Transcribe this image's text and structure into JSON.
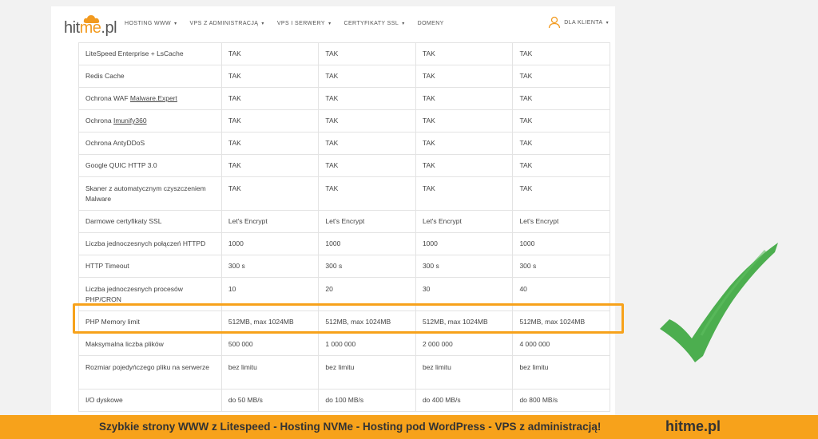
{
  "header": {
    "logo": "hitme.pl",
    "nav": [
      "HOSTING WWW",
      "VPS Z ADMINISTRACJĄ",
      "VPS I SERWERY",
      "CERTYFIKATY SSL",
      "DOMENY"
    ],
    "client_label": "DLA KLIENTA"
  },
  "table": {
    "rows": [
      {
        "label": "LiteSpeed Enterprise + LsCache",
        "values": [
          "TAK",
          "TAK",
          "TAK",
          "TAK"
        ]
      },
      {
        "label": "Redis Cache",
        "values": [
          "TAK",
          "TAK",
          "TAK",
          "TAK"
        ]
      },
      {
        "label_prefix": "Ochrona WAF ",
        "label_link": "Malware.Expert",
        "values": [
          "TAK",
          "TAK",
          "TAK",
          "TAK"
        ]
      },
      {
        "label_prefix": "Ochrona ",
        "label_link": "Imunify360",
        "values": [
          "TAK",
          "TAK",
          "TAK",
          "TAK"
        ]
      },
      {
        "label": "Ochrona AntyDDoS",
        "values": [
          "TAK",
          "TAK",
          "TAK",
          "TAK"
        ]
      },
      {
        "label": "Google QUIC HTTP 3.0",
        "values": [
          "TAK",
          "TAK",
          "TAK",
          "TAK"
        ]
      },
      {
        "label": "Skaner z automatycznym czyszczeniem Malware",
        "values": [
          "TAK",
          "TAK",
          "TAK",
          "TAK"
        ]
      },
      {
        "label": "Darmowe certyfikaty SSL",
        "values": [
          "Let's Encrypt",
          "Let's Encrypt",
          "Let's Encrypt",
          "Let's Encrypt"
        ]
      },
      {
        "label": "Liczba jednoczesnych połączeń HTTPD",
        "values": [
          "1000",
          "1000",
          "1000",
          "1000"
        ]
      },
      {
        "label": "HTTP Timeout",
        "values": [
          "300 s",
          "300 s",
          "300 s",
          "300 s"
        ]
      },
      {
        "label": "Liczba jednoczesnych procesów PHP/CRON",
        "values": [
          "10",
          "20",
          "30",
          "40"
        ]
      },
      {
        "label": "PHP Memory limit",
        "values": [
          "512MB, max 1024MB",
          "512MB, max 1024MB",
          "512MB, max 1024MB",
          "512MB, max 1024MB"
        ]
      },
      {
        "label": "Maksymalna liczba plików",
        "values": [
          "500 000",
          "1 000 000",
          "2 000 000",
          "4 000 000"
        ]
      },
      {
        "label": "Rozmiar pojedyńczego pliku na serwerze",
        "values": [
          "bez limitu",
          "bez limitu",
          "bez limitu",
          "bez limitu"
        ]
      },
      {
        "label": "I/O dyskowe",
        "values": [
          "do 50 MB/s",
          "do 100 MB/s",
          "do 400 MB/s",
          "do 800 MB/s"
        ]
      }
    ]
  },
  "colors": {
    "accent": "#f7a21b",
    "check": "#4cae4f"
  },
  "footer": {
    "text": "Szybkie strony WWW z Litespeed - Hosting  NVMe - Hosting pod WordPress - VPS z administracją!",
    "brand": "hitme.pl"
  }
}
